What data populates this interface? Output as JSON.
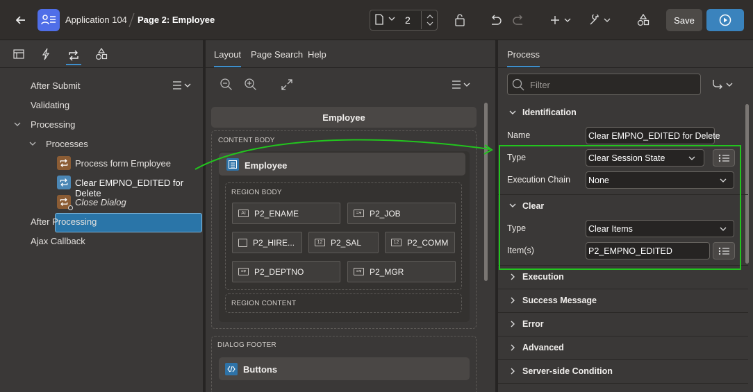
{
  "header": {
    "app_name": "Application 104",
    "page_name": "Page 2: Employee",
    "page_number": "2",
    "save_label": "Save"
  },
  "left_pane": {
    "tree": [
      {
        "label": "After Submit"
      },
      {
        "label": "Validating"
      },
      {
        "label": "Processing"
      },
      {
        "label": "Processes"
      },
      {
        "label": "Process form Employee"
      },
      {
        "label": "Clear EMPNO_EDITED for Delete"
      },
      {
        "label": "Close Dialog"
      },
      {
        "label": "After Processing"
      },
      {
        "label": "Ajax Callback"
      }
    ]
  },
  "mid_pane": {
    "tabs": [
      "Layout",
      "Page Search",
      "Help"
    ],
    "dialog_title": "Employee",
    "content_body_label": "CONTENT BODY",
    "region_name": "Employee",
    "region_body_label": "REGION BODY",
    "items": [
      "P2_ENAME",
      "P2_JOB",
      "P2_HIRE...",
      "P2_SAL",
      "P2_COMM",
      "P2_DEPTNO",
      "P2_MGR"
    ],
    "region_content_label": "REGION CONTENT",
    "dialog_footer_label": "DIALOG FOOTER",
    "buttons_region": "Buttons"
  },
  "right_pane": {
    "tab": "Process",
    "filter_placeholder": "Filter",
    "identification": {
      "title": "Identification",
      "name_label": "Name",
      "name_value": "Clear EMPNO_EDITED for Delete",
      "type_label": "Type",
      "type_value": "Clear Session State",
      "chain_label": "Execution Chain",
      "chain_value": "None"
    },
    "clear": {
      "title": "Clear",
      "type_label": "Type",
      "type_value": "Clear Items",
      "items_label": "Item(s)",
      "items_value": "P2_EMPNO_EDITED"
    },
    "collapsed_sections": [
      "Execution",
      "Success Message",
      "Error",
      "Advanced",
      "Server-side Condition"
    ]
  },
  "colors": {
    "highlight_green": "#22c51e",
    "selection_blue": "#2a75a8",
    "run_button": "#3a83bd",
    "app_icon": "#4f6ee8"
  }
}
